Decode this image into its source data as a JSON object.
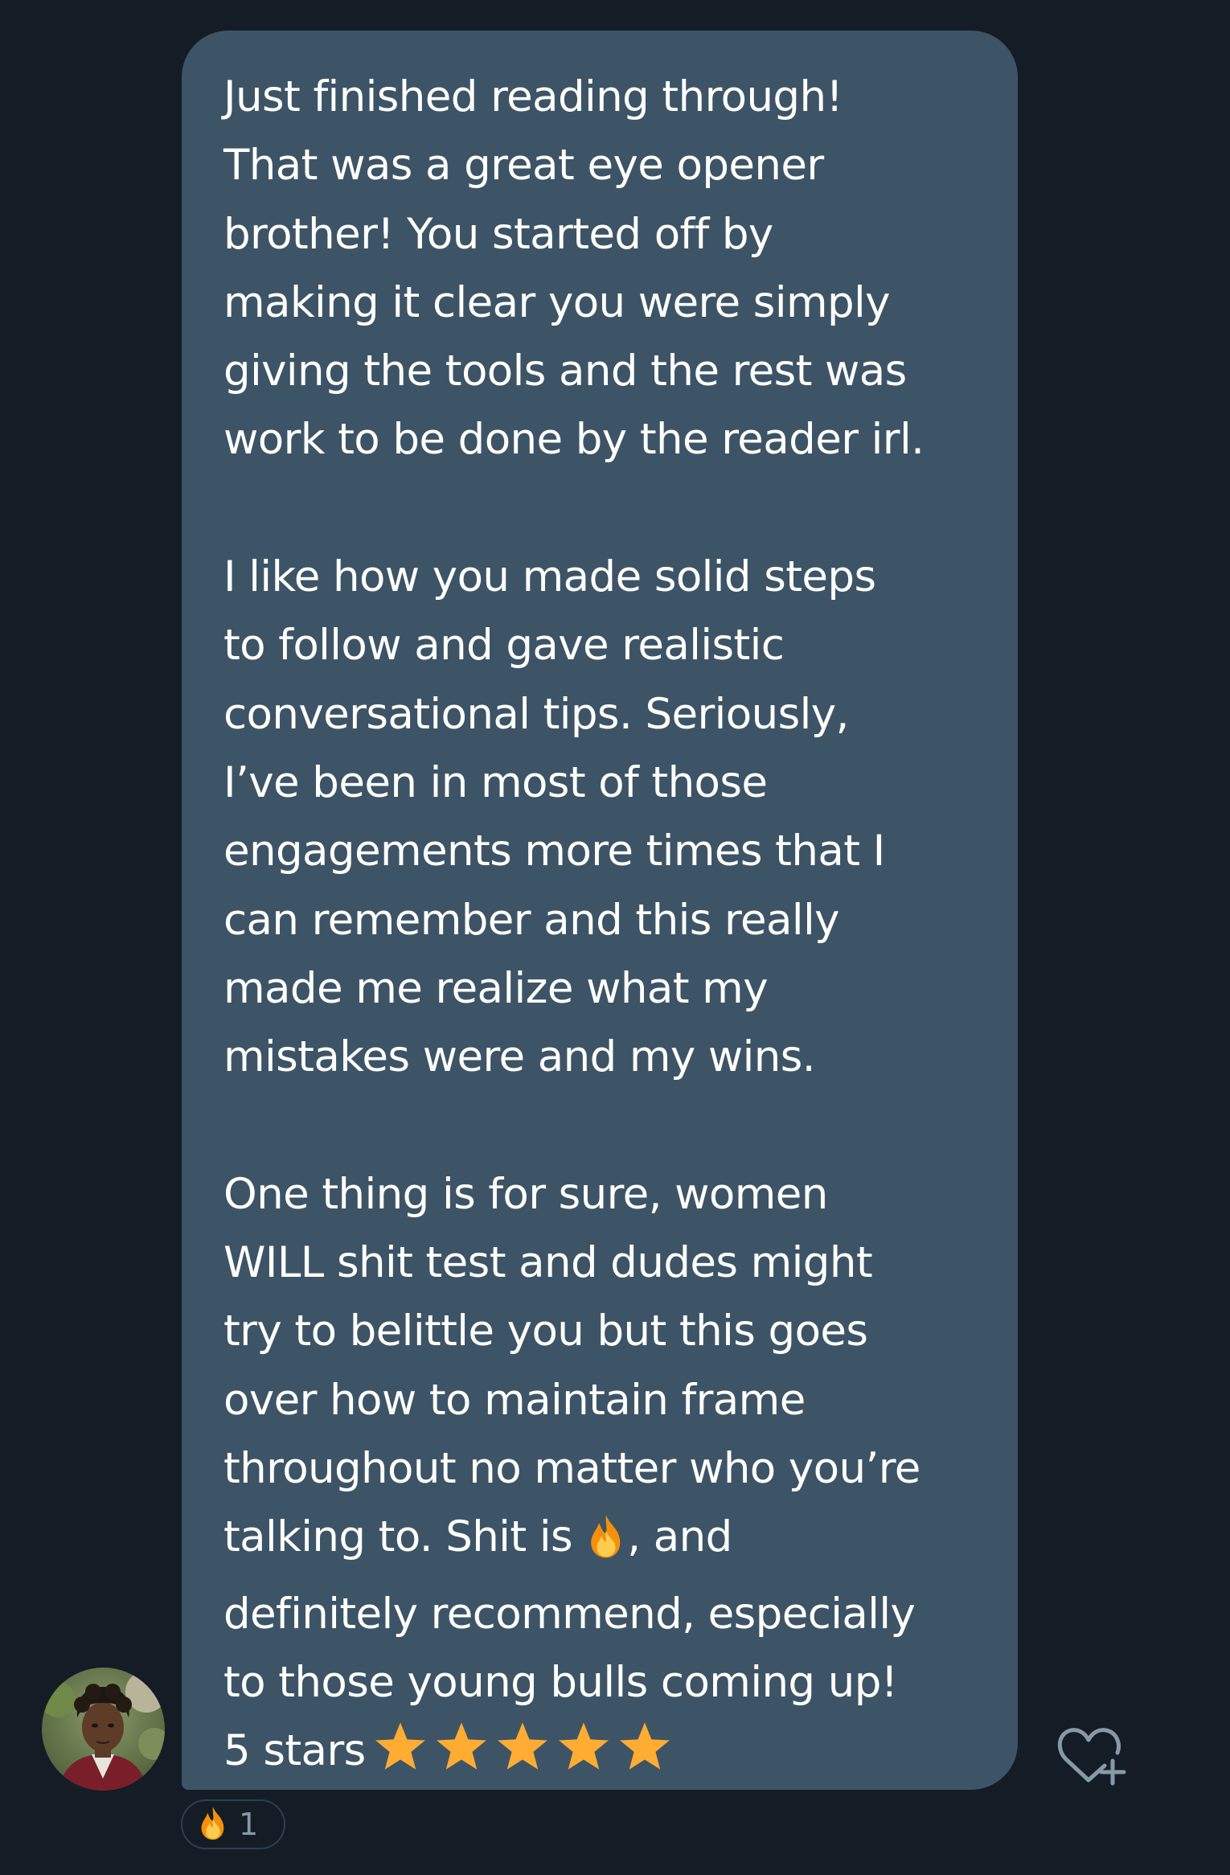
{
  "message": {
    "paragraph_1": "Just finished reading through!\nThat was a great eye opener\nbrother! You started off by\nmaking it clear you were simply\ngiving the tools and the rest was\nwork to be done by the reader irl.",
    "paragraph_2": "I like how you made solid steps\nto follow and gave realistic\nconversational tips. Seriously,\nI’ve been in most of those\nengagements more times that I\ncan remember and this really\nmade me realize what my\nmistakes were and my wins.",
    "paragraph_3_before_emoji": "One thing is for sure, women\nWILL shit test and dudes might\ntry to belittle you but this goes\nover how to maintain frame\nthroughout no matter who you’re\ntalking to. Shit is ",
    "inline_emoji": "fire-emoji",
    "paragraph_3_after_emoji": ", and\ndefinitely recommend, especially\nto those young bulls coming up!\n",
    "rating_text": "5 stars",
    "rating_stars": 5,
    "star_color": "#ffac33"
  },
  "reaction": {
    "emoji": "fire-emoji",
    "count": "1"
  },
  "colors": {
    "background": "#141d26",
    "bubble": "#3d5466",
    "text": "#ffffff",
    "muted": "#8899a6"
  },
  "icons": {
    "avatar": "user-avatar",
    "react_button": "heart-plus-icon"
  }
}
